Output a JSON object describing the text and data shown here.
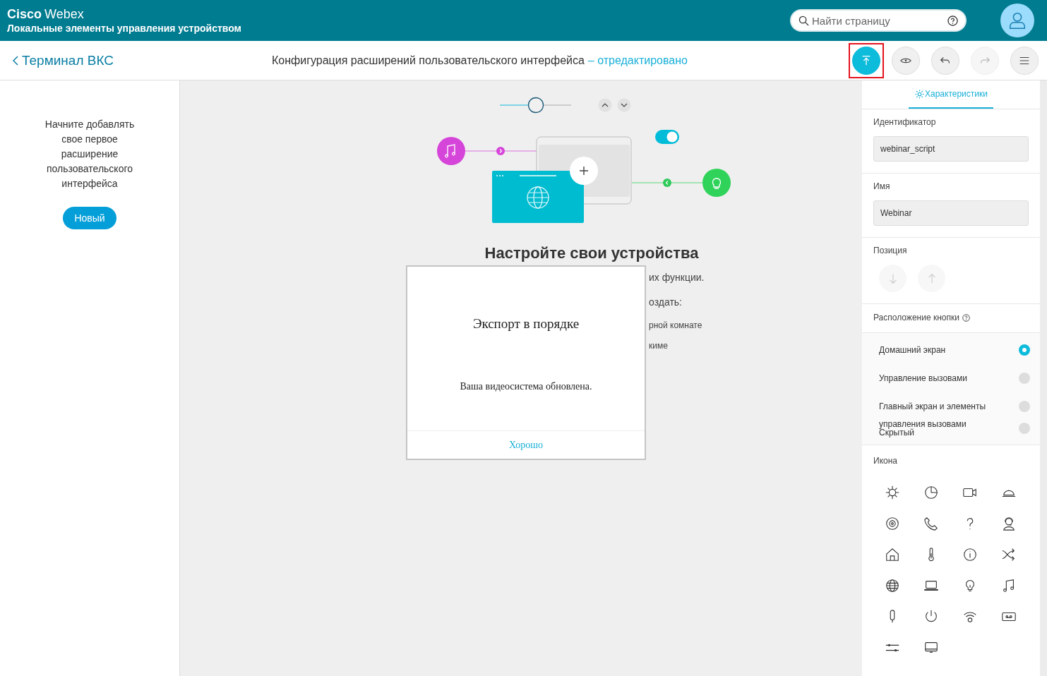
{
  "header": {
    "brand_bold": "Cisco",
    "brand_light": "Webex",
    "subtitle": "Локальные элементы управления устройством",
    "search": {
      "placeholder": "Найти страницу"
    }
  },
  "toolbar": {
    "back": "Терминал ВКС",
    "title": "Конфигурация расширений пользовательского интерфейса",
    "status": "– отредактировано",
    "buttons": [
      {
        "kind": "export",
        "highlighted": true,
        "disabled": false
      },
      {
        "kind": "preview",
        "highlighted": false,
        "disabled": false
      },
      {
        "kind": "undo",
        "highlighted": false,
        "disabled": false
      },
      {
        "kind": "redo",
        "highlighted": false,
        "disabled": true
      },
      {
        "kind": "menu",
        "highlighted": false,
        "disabled": false
      }
    ]
  },
  "left_panel": {
    "message": "Начните добавлять свое первое расширение пользовательского интерфейса",
    "button": "Новый"
  },
  "canvas": {
    "heading": "Настройте свои устройства",
    "lines": [
      "их функции.",
      "оздать:",
      "рной комнате",
      "киме"
    ]
  },
  "dialog": {
    "title": "Экспорт в порядке",
    "message": "Ваша видеосистема обновлена.",
    "button": "Хорошо"
  },
  "properties": {
    "tab": {
      "label": "Характеристики",
      "selected": true
    },
    "id": {
      "label": "Идентификатор",
      "value": "webinar_script"
    },
    "name": {
      "label": "Имя",
      "value": "Webinar"
    },
    "position": {
      "label": "Позиция"
    },
    "placement": {
      "label": "Расположение кнопки",
      "options": [
        {
          "lines": [
            "Домашний экран"
          ],
          "selected": true
        },
        {
          "lines": [
            "Управление вызовами"
          ],
          "selected": false
        },
        {
          "lines": [
            "Главный экран и элементы"
          ],
          "selected": false
        },
        {
          "lines": [
            "управления вызовами",
            "Скрытый"
          ],
          "selected": false
        }
      ]
    },
    "icon": {
      "label": "Икона"
    }
  }
}
